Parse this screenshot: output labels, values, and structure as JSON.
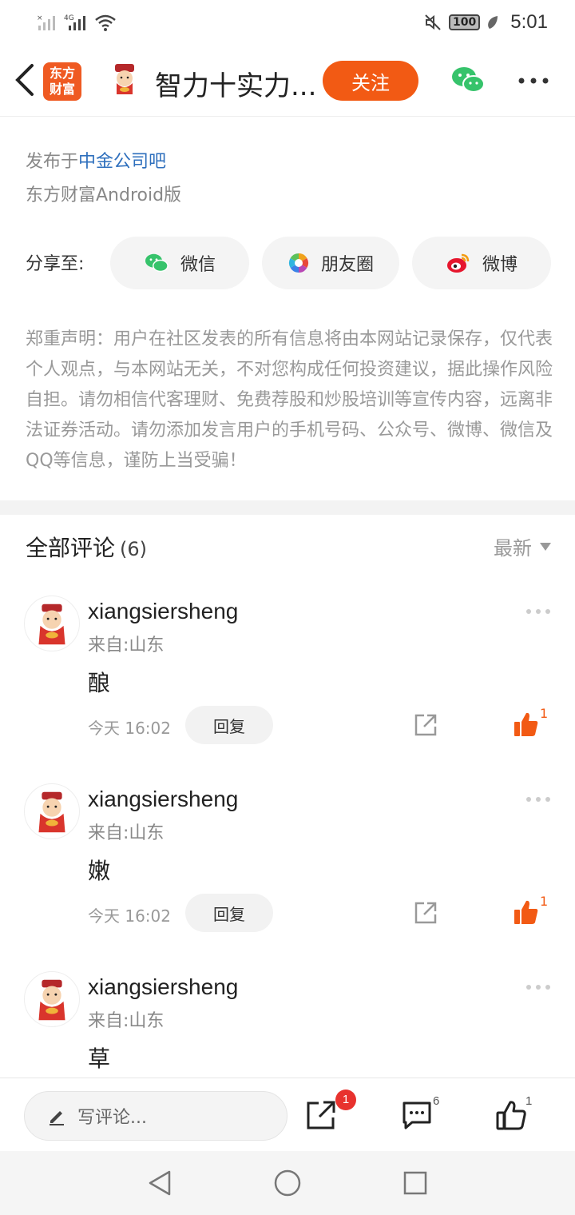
{
  "status": {
    "battery": "100",
    "time": "5:01"
  },
  "header": {
    "title": "智力十实力...",
    "follow_label": "关注",
    "logo_text_1": "东方",
    "logo_text_2": "财富"
  },
  "info": {
    "published_prefix": "发布于",
    "bar_name": "中金公司吧",
    "client": "东方财富Android版"
  },
  "share": {
    "label": "分享至:",
    "buttons": [
      {
        "label": "微信",
        "icon": "wechat-icon"
      },
      {
        "label": "朋友圈",
        "icon": "moments-icon"
      },
      {
        "label": "微博",
        "icon": "weibo-icon"
      }
    ]
  },
  "disclaimer": "郑重声明：用户在社区发表的所有信息将由本网站记录保存，仅代表个人观点，与本网站无关，不对您构成任何投资建议，据此操作风险自担。请勿相信代客理财、免费荐股和炒股培训等宣传内容，远离非法证券活动。请勿添加发言用户的手机号码、公众号、微博、微信及QQ等信息，谨防上当受骗！",
  "comments_section": {
    "title": "全部评论",
    "count": "(6)",
    "sort_label": "最新"
  },
  "comments": [
    {
      "user": "xiangsiersheng",
      "location": "来自:山东",
      "body": "酿",
      "time": "今天 16:02",
      "reply_label": "回复",
      "likes": "1"
    },
    {
      "user": "xiangsiersheng",
      "location": "来自:山东",
      "body": "嫩",
      "time": "今天 16:02",
      "reply_label": "回复",
      "likes": "1"
    },
    {
      "user": "xiangsiersheng",
      "location": "来自:山东",
      "body": "草",
      "time": "",
      "reply_label": "",
      "likes": ""
    }
  ],
  "bottom_bar": {
    "write_placeholder": "写评论...",
    "share_badge": "1",
    "comment_count": "6",
    "like_count": "1"
  },
  "colors": {
    "accent": "#f25a14",
    "link": "#2e6fbd",
    "badge": "#e8322e"
  }
}
